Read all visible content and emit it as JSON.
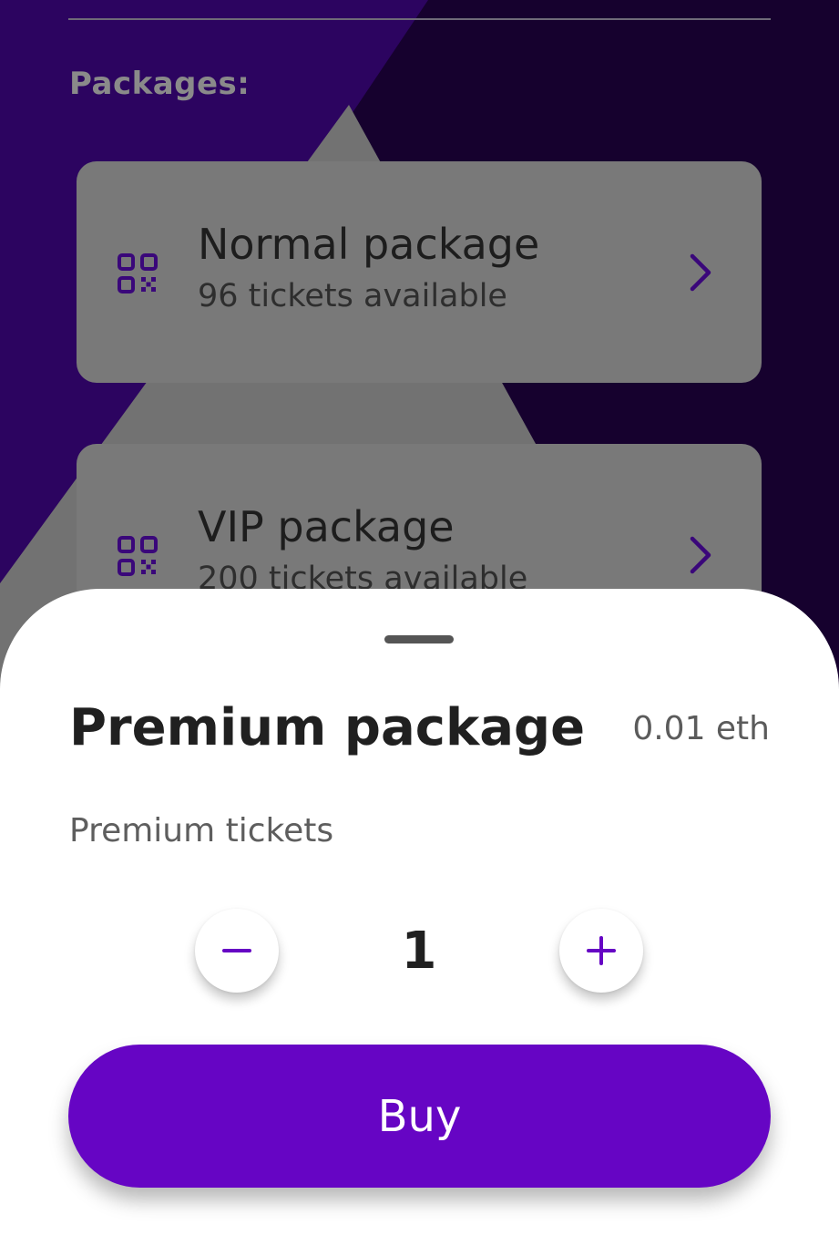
{
  "packages_section": {
    "label": "Packages:"
  },
  "packages": [
    {
      "title": "Normal package",
      "subtitle": "96 tickets available"
    },
    {
      "title": "VIP package",
      "subtitle": "200 tickets available"
    }
  ],
  "sheet": {
    "title": "Premium package",
    "price": "0.01 eth",
    "description": "Premium tickets",
    "quantity": "1",
    "buy_label": "Buy"
  },
  "icons": {
    "package": "qr-code-icon",
    "open": "chevron-right-icon",
    "decrement": "minus-icon",
    "increment": "plus-icon"
  },
  "colors": {
    "accent": "#6605c4",
    "background_dark": "#16012e",
    "background_purple": "#2c0460",
    "card": "#797979"
  }
}
